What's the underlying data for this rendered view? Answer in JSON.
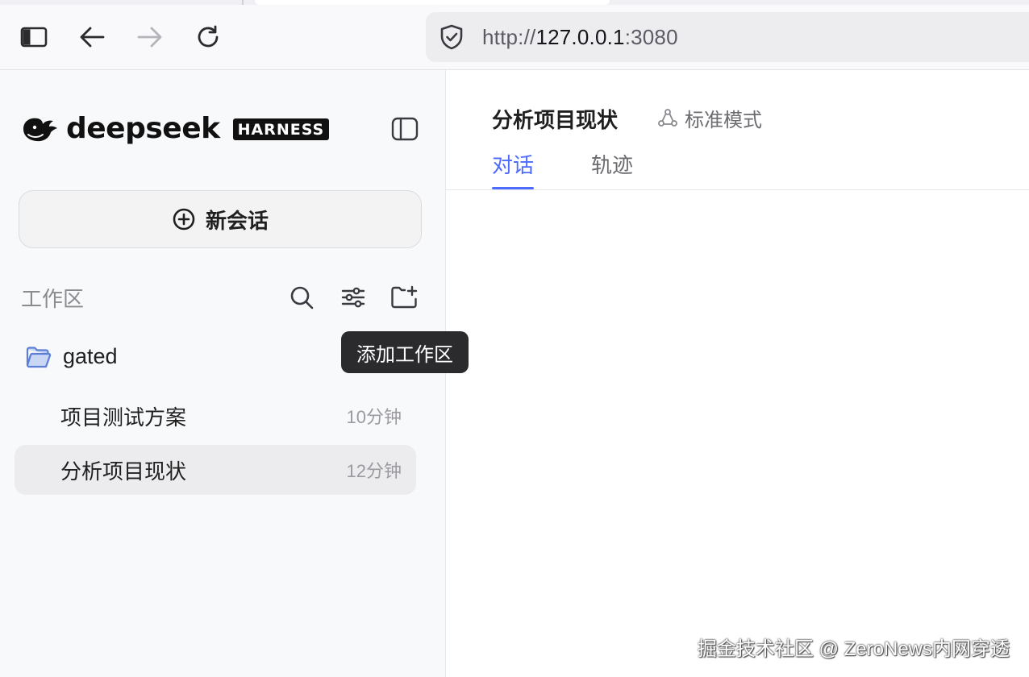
{
  "browser": {
    "url_scheme": "http://",
    "url_host": "127.0.0.1",
    "url_port": ":3080",
    "icons": [
      "sidebar-toggle-icon",
      "back-arrow-icon",
      "forward-arrow-icon",
      "reload-icon",
      "shield-icon"
    ]
  },
  "sidebar": {
    "brand_word": "deepseek",
    "brand_badge": "HARNESS",
    "new_chat_label": "新会话",
    "workspace_title": "工作区",
    "workspace_actions": [
      "search-icon",
      "filter-icon",
      "add-folder-icon"
    ],
    "tooltip": "添加工作区",
    "folder": {
      "name": "gated",
      "sessions": [
        {
          "title": "项目测试方案",
          "time": "10分钟",
          "active": false
        },
        {
          "title": "分析项目现状",
          "time": "12分钟",
          "active": true
        }
      ]
    }
  },
  "main": {
    "title": "分析项目现状",
    "mode_label": "标准模式",
    "tabs": [
      {
        "label": "对话",
        "active": true
      },
      {
        "label": "轨迹",
        "active": false
      }
    ]
  },
  "watermark": "掘金技术社区 @ ZeroNews内网穿透",
  "colors": {
    "accent": "#4d6bfe",
    "folder": "#5b7fd6",
    "sidebar_bg": "#f8f9fb",
    "tooltip_bg": "#2b2b2d"
  }
}
